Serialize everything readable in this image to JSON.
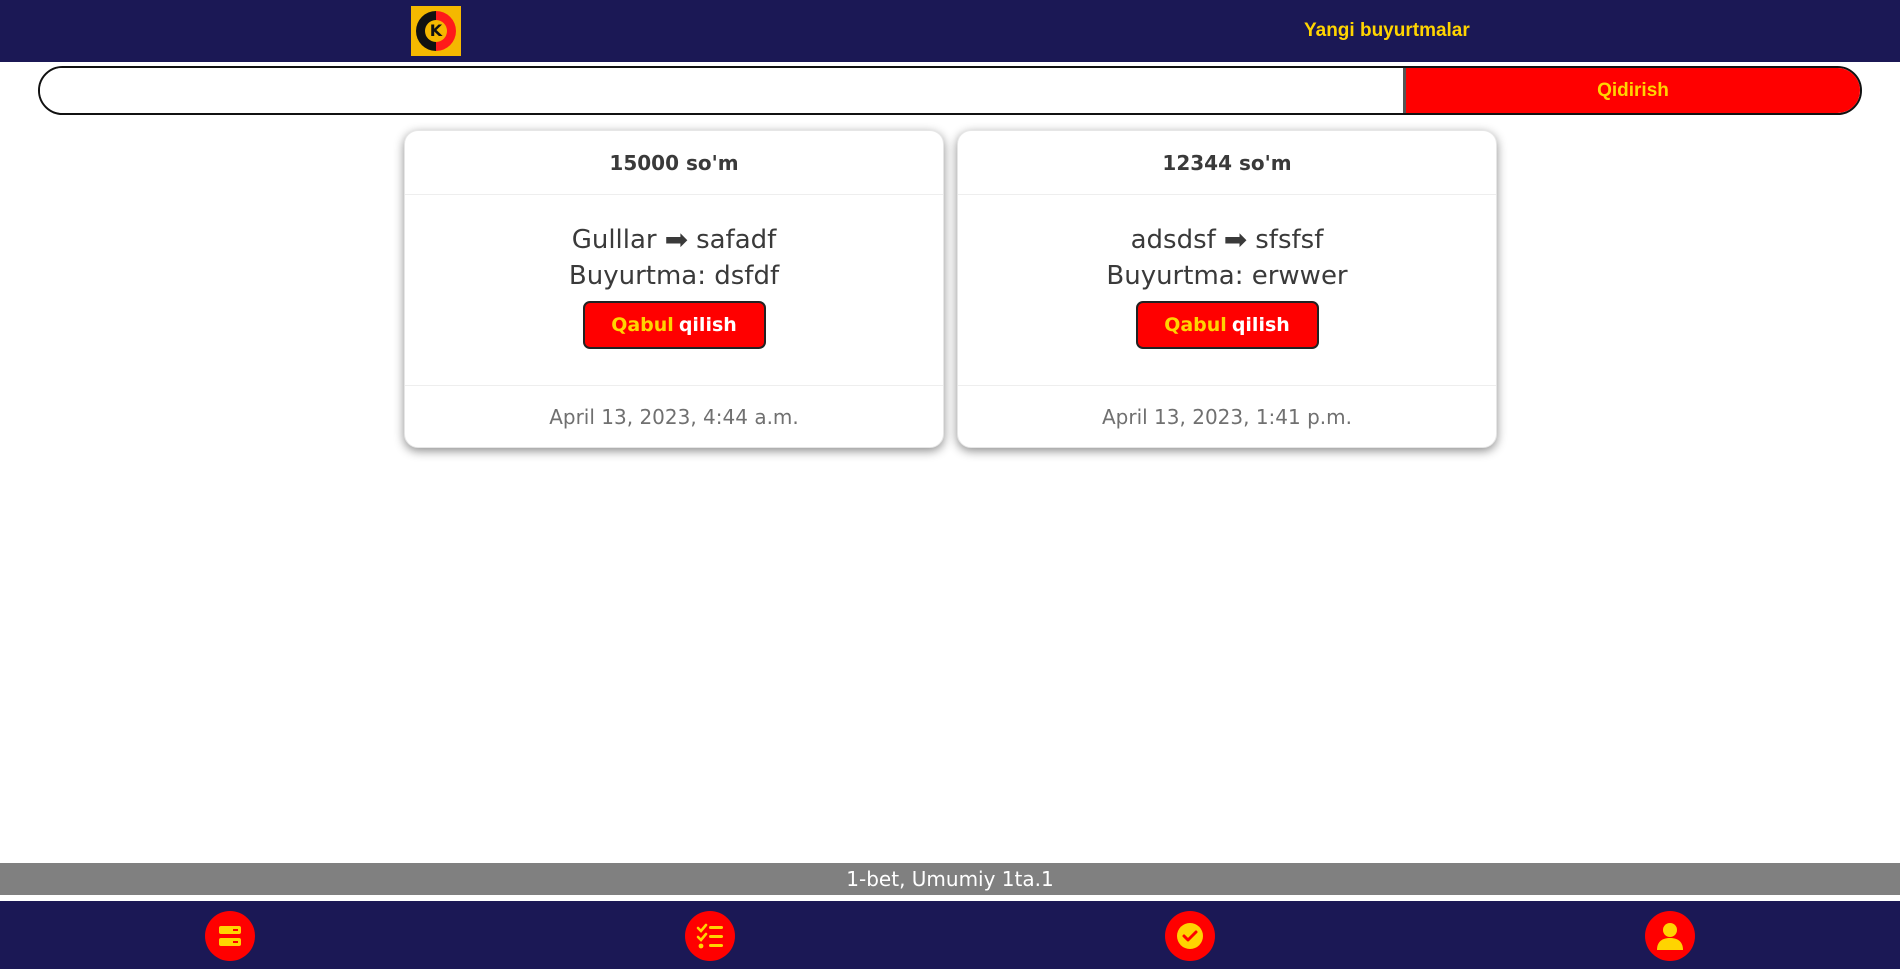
{
  "header": {
    "title": "Yangi buyurtmalar",
    "logo_letter": "K"
  },
  "search": {
    "value": "",
    "placeholder": "",
    "button_label": "Qidirish"
  },
  "orders": [
    {
      "price": "15000 so'm",
      "from": "Gulllar",
      "to": "safadf",
      "order_text": "Buyurtma: dsfdf",
      "accept_word1": "Qabul",
      "accept_word2": "qilish",
      "date": "April 13, 2023, 4:44 a.m."
    },
    {
      "price": "12344 so'm",
      "from": "adsdsf",
      "to": "sfsfsf",
      "order_text": "Buyurtma: erwwer",
      "accept_word1": "Qabul",
      "accept_word2": "qilish",
      "date": "April 13, 2023, 1:41 p.m."
    }
  ],
  "pager": {
    "text": "1-bet, Umumiy 1ta.1"
  },
  "bottom_nav": {
    "items": [
      {
        "icon": "orders-list-icon"
      },
      {
        "icon": "checklist-icon"
      },
      {
        "icon": "check-circle-icon"
      },
      {
        "icon": "user-icon"
      }
    ]
  },
  "colors": {
    "navy": "#1b1855",
    "red": "#ff0000",
    "yellow": "#ffd400",
    "pager_gray": "#808080"
  }
}
